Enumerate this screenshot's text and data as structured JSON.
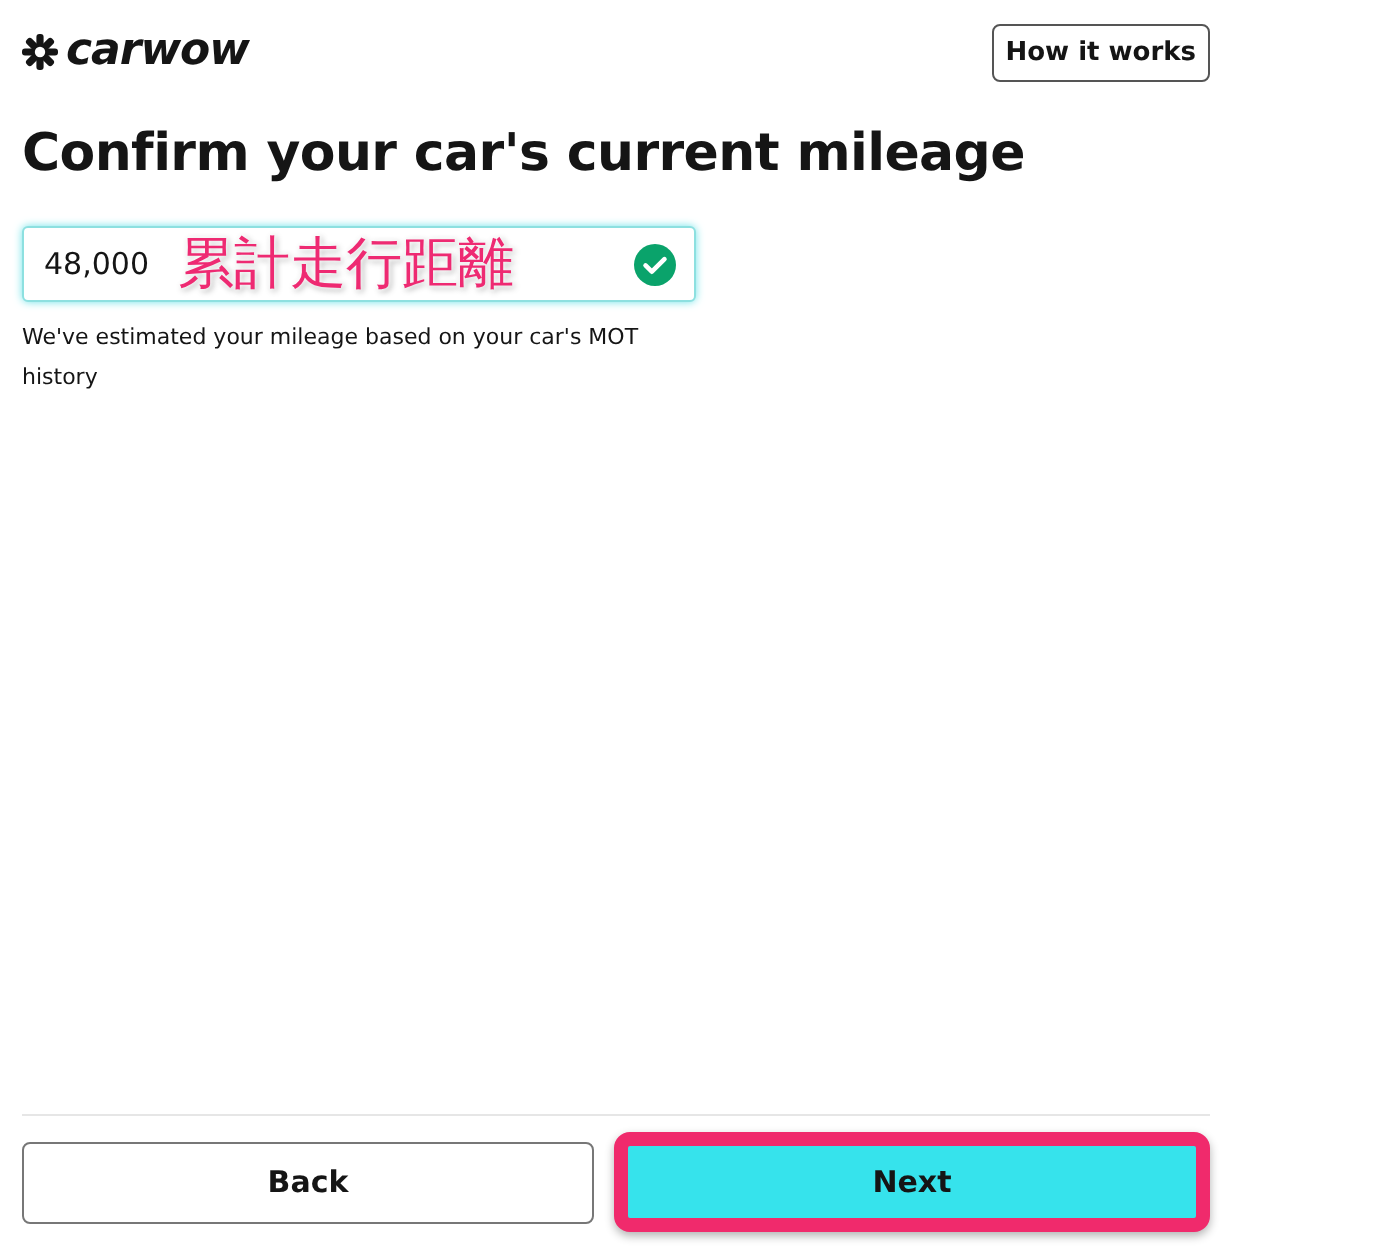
{
  "header": {
    "logo": "carwow",
    "help_button": "How it works"
  },
  "title": "Confirm your car's current mileage",
  "mileage_field": {
    "value": "48,000",
    "valid": true
  },
  "annotation": {
    "text": "累計走行距離"
  },
  "helper_text": "We've estimated your mileage based on your car's MOT history",
  "buttons": [
    {
      "label": "Back",
      "kind": "secondary",
      "highlighted": false
    },
    {
      "label": "Next",
      "kind": "primary",
      "highlighted": true
    }
  ]
}
